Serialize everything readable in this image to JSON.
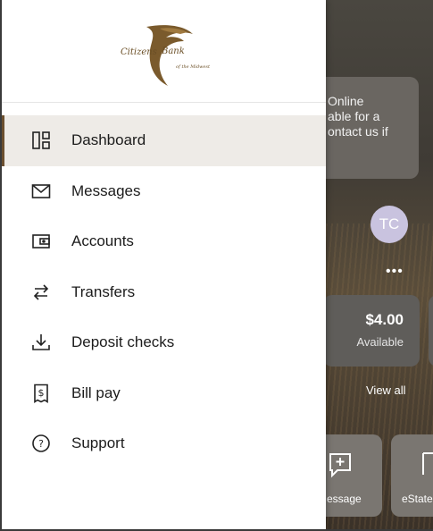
{
  "background": {
    "notice_text": "Online\nable for a\nontact us if",
    "avatar_initials": "TC",
    "more_label": "•••",
    "account": {
      "amount": "$4.00",
      "available_label": "Available"
    },
    "view_all_label": "View all",
    "tiles": [
      {
        "label": "essage",
        "icon": "message-plus-icon"
      },
      {
        "label": "eState",
        "icon": "estatement-icon"
      }
    ]
  },
  "drawer": {
    "logo": {
      "line1": "Citizens",
      "line2": "Bank",
      "line3": "of the Midwest"
    },
    "menu": [
      {
        "label": "Dashboard",
        "icon": "dashboard-icon",
        "active": true
      },
      {
        "label": "Messages",
        "icon": "mail-icon",
        "active": false
      },
      {
        "label": "Accounts",
        "icon": "wallet-icon",
        "active": false
      },
      {
        "label": "Transfers",
        "icon": "transfer-arrows-icon",
        "active": false
      },
      {
        "label": "Deposit checks",
        "icon": "deposit-download-icon",
        "active": false
      },
      {
        "label": "Bill pay",
        "icon": "bill-dollar-icon",
        "active": false
      },
      {
        "label": "Support",
        "icon": "help-circle-icon",
        "active": false
      }
    ]
  },
  "colors": {
    "accent": "#6b4f2f",
    "active_bg": "#eeebe7"
  }
}
